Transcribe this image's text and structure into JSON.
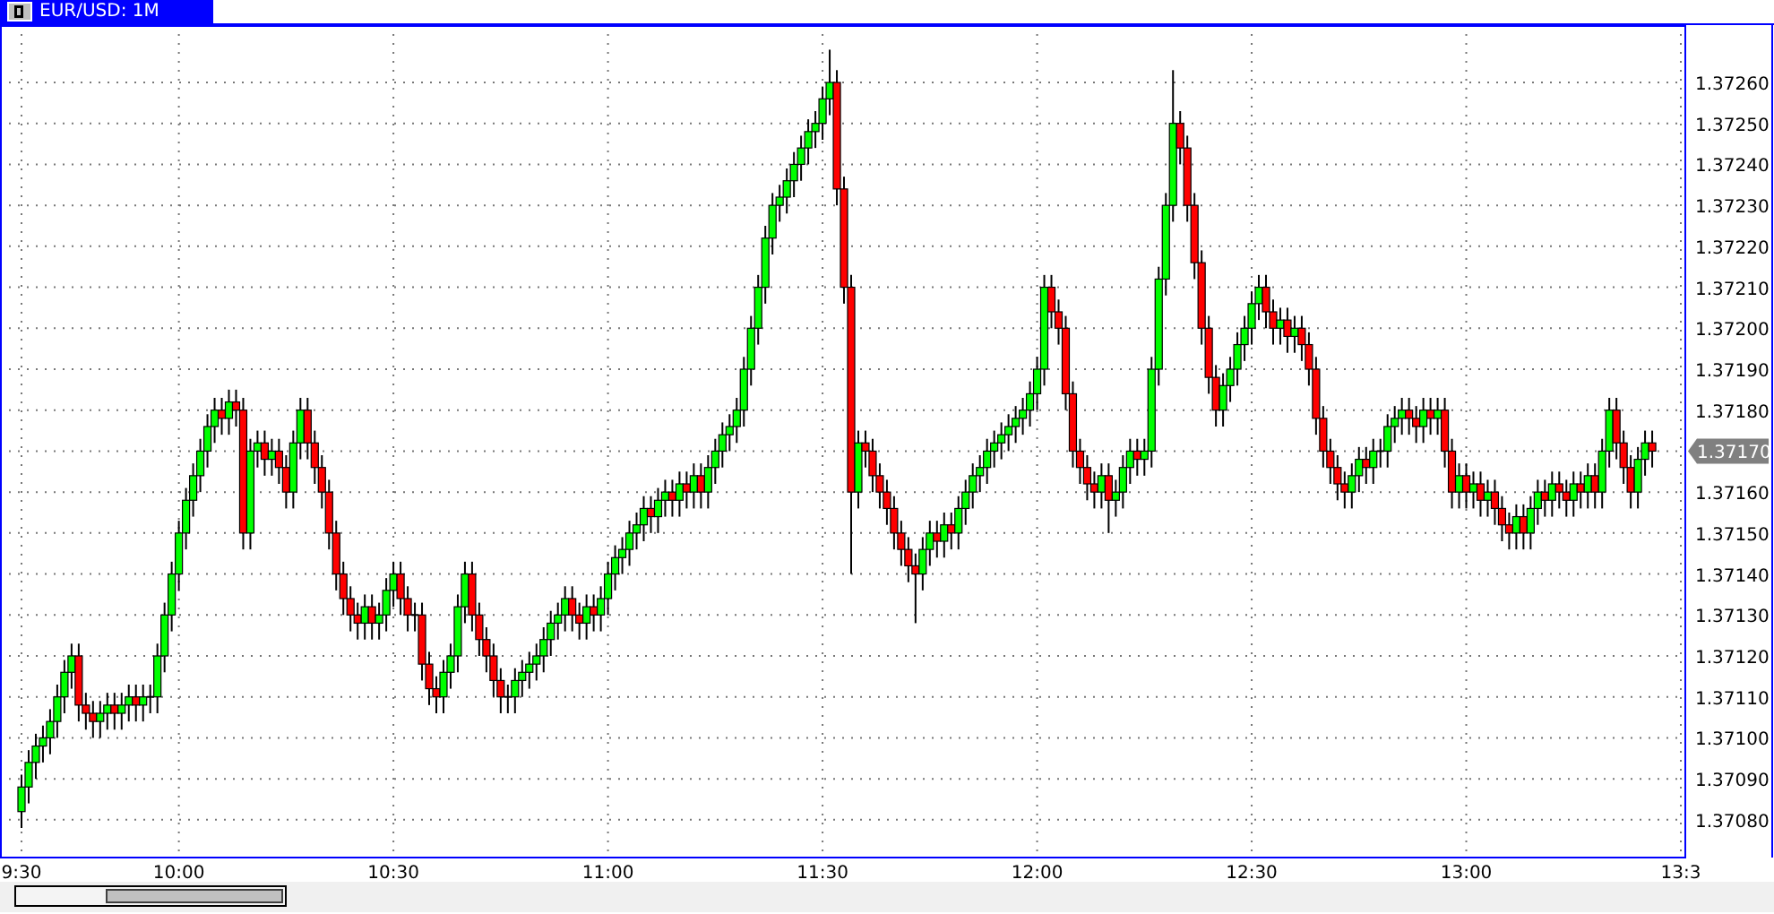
{
  "window": {
    "title": "EUR/USD: 1M"
  },
  "chart_data": {
    "type": "candlestick",
    "categories": [
      "9:30",
      null,
      null,
      null,
      null,
      null,
      null,
      null,
      null,
      null,
      null,
      null,
      null,
      null,
      null,
      null,
      null,
      null,
      null,
      null,
      null,
      null,
      "10:00",
      null,
      null,
      null,
      null,
      null,
      null,
      null,
      null,
      null,
      null,
      null,
      null,
      null,
      null,
      null,
      null,
      null,
      null,
      null,
      null,
      null,
      null,
      null,
      null,
      null,
      null,
      null,
      null,
      null,
      "10:30",
      null,
      null,
      null,
      null,
      null,
      null,
      null,
      null,
      null,
      null,
      null,
      null,
      null,
      null,
      null,
      null,
      null,
      null,
      null,
      null,
      null,
      null,
      null,
      null,
      null,
      null,
      null,
      null,
      null,
      "11:00",
      null,
      null,
      null,
      null,
      null,
      null,
      null,
      null,
      null,
      null,
      null,
      null,
      null,
      null,
      null,
      null,
      null,
      null,
      null,
      null,
      null,
      null,
      null,
      null,
      null,
      null,
      null,
      null,
      null,
      "11:30",
      null,
      null,
      null,
      null,
      null,
      null,
      null,
      null,
      null,
      null,
      null,
      null,
      null,
      null,
      null,
      null,
      null,
      null,
      null,
      null,
      null,
      null,
      null,
      null,
      null,
      null,
      null,
      null,
      null,
      "12:00",
      null,
      null,
      null,
      null,
      null,
      null,
      null,
      null,
      null,
      null,
      null,
      null,
      null,
      null,
      null,
      null,
      null,
      null,
      null,
      null,
      null,
      null,
      null,
      null,
      null,
      null,
      null,
      null,
      null,
      "12:30",
      null,
      null,
      null,
      null,
      null,
      null,
      null,
      null,
      null,
      null,
      null,
      null,
      null,
      null,
      null,
      null,
      null,
      null,
      null,
      null,
      null,
      null,
      null,
      null,
      null,
      null,
      null,
      null,
      null,
      "13:00",
      null,
      null,
      null,
      null,
      null,
      null,
      null,
      null,
      null,
      null,
      null,
      null,
      null,
      null,
      null,
      null,
      null,
      null,
      null,
      null,
      null,
      null,
      null,
      null,
      null,
      null,
      null,
      null,
      null,
      "13:3"
    ],
    "ohlc": [
      [
        1.37082,
        1.37091,
        1.37078,
        1.37088
      ],
      [
        1.37088,
        1.37097,
        1.37084,
        1.37094
      ],
      [
        1.37094,
        1.37101,
        1.3709,
        1.37098
      ],
      [
        1.37098,
        1.37103,
        1.37094,
        1.371
      ],
      [
        1.371,
        1.37107,
        1.37096,
        1.37104
      ],
      [
        1.37104,
        1.37113,
        1.371,
        1.3711
      ],
      [
        1.3711,
        1.37119,
        1.37106,
        1.37116
      ],
      [
        1.37116,
        1.37123,
        1.37112,
        1.3712
      ],
      [
        1.3712,
        1.37123,
        1.37104,
        1.37108
      ],
      [
        1.37108,
        1.37111,
        1.37102,
        1.37106
      ],
      [
        1.37106,
        1.37109,
        1.371,
        1.37104
      ],
      [
        1.37104,
        1.37109,
        1.371,
        1.37106
      ],
      [
        1.37106,
        1.37111,
        1.37102,
        1.37108
      ],
      [
        1.37108,
        1.37111,
        1.37102,
        1.37106
      ],
      [
        1.37106,
        1.37111,
        1.37102,
        1.37108
      ],
      [
        1.37108,
        1.37113,
        1.37104,
        1.3711
      ],
      [
        1.3711,
        1.37113,
        1.37104,
        1.37108
      ],
      [
        1.37108,
        1.37113,
        1.37104,
        1.3711
      ],
      [
        1.3711,
        1.37113,
        1.37106,
        1.3711
      ],
      [
        1.3711,
        1.37123,
        1.37106,
        1.3712
      ],
      [
        1.3712,
        1.37133,
        1.37116,
        1.3713
      ],
      [
        1.3713,
        1.37143,
        1.37126,
        1.3714
      ],
      [
        1.3714,
        1.37153,
        1.37136,
        1.3715
      ],
      [
        1.3715,
        1.37161,
        1.37146,
        1.37158
      ],
      [
        1.37158,
        1.37167,
        1.37154,
        1.37164
      ],
      [
        1.37164,
        1.37173,
        1.3716,
        1.3717
      ],
      [
        1.3717,
        1.37179,
        1.37166,
        1.37176
      ],
      [
        1.37176,
        1.37183,
        1.37172,
        1.3718
      ],
      [
        1.3718,
        1.37183,
        1.37174,
        1.37178
      ],
      [
        1.37178,
        1.37185,
        1.37174,
        1.37182
      ],
      [
        1.37182,
        1.37185,
        1.37176,
        1.3718
      ],
      [
        1.3718,
        1.37183,
        1.37146,
        1.3715
      ],
      [
        1.3715,
        1.37173,
        1.37146,
        1.3717
      ],
      [
        1.3717,
        1.37175,
        1.37166,
        1.37172
      ],
      [
        1.37172,
        1.37175,
        1.37164,
        1.37168
      ],
      [
        1.37168,
        1.37173,
        1.37164,
        1.3717
      ],
      [
        1.3717,
        1.37173,
        1.37162,
        1.37166
      ],
      [
        1.37166,
        1.37169,
        1.37156,
        1.3716
      ],
      [
        1.3716,
        1.37175,
        1.37156,
        1.37172
      ],
      [
        1.37172,
        1.37183,
        1.37168,
        1.3718
      ],
      [
        1.3718,
        1.37183,
        1.37168,
        1.37172
      ],
      [
        1.37172,
        1.37175,
        1.37162,
        1.37166
      ],
      [
        1.37166,
        1.37169,
        1.37156,
        1.3716
      ],
      [
        1.3716,
        1.37163,
        1.37146,
        1.3715
      ],
      [
        1.3715,
        1.37153,
        1.37136,
        1.3714
      ],
      [
        1.3714,
        1.37143,
        1.3713,
        1.37134
      ],
      [
        1.37134,
        1.37137,
        1.37126,
        1.3713
      ],
      [
        1.3713,
        1.37133,
        1.37124,
        1.37128
      ],
      [
        1.37128,
        1.37135,
        1.37124,
        1.37132
      ],
      [
        1.37132,
        1.37135,
        1.37124,
        1.37128
      ],
      [
        1.37128,
        1.37133,
        1.37124,
        1.3713
      ],
      [
        1.3713,
        1.37139,
        1.37126,
        1.37136
      ],
      [
        1.37136,
        1.37143,
        1.37132,
        1.3714
      ],
      [
        1.3714,
        1.37143,
        1.3713,
        1.37134
      ],
      [
        1.37134,
        1.37137,
        1.37126,
        1.3713
      ],
      [
        1.3713,
        1.37133,
        1.37126,
        1.3713
      ],
      [
        1.3713,
        1.37133,
        1.37114,
        1.37118
      ],
      [
        1.37118,
        1.37121,
        1.37108,
        1.37112
      ],
      [
        1.37112,
        1.37115,
        1.37106,
        1.3711
      ],
      [
        1.3711,
        1.37119,
        1.37106,
        1.37116
      ],
      [
        1.37116,
        1.37123,
        1.37112,
        1.3712
      ],
      [
        1.3712,
        1.37135,
        1.37116,
        1.37132
      ],
      [
        1.37132,
        1.37143,
        1.37128,
        1.3714
      ],
      [
        1.3714,
        1.37143,
        1.37126,
        1.3713
      ],
      [
        1.3713,
        1.37133,
        1.3712,
        1.37124
      ],
      [
        1.37124,
        1.37127,
        1.37116,
        1.3712
      ],
      [
        1.3712,
        1.37123,
        1.3711,
        1.37114
      ],
      [
        1.37114,
        1.37117,
        1.37106,
        1.3711
      ],
      [
        1.3711,
        1.37113,
        1.37106,
        1.3711
      ],
      [
        1.3711,
        1.37117,
        1.37106,
        1.37114
      ],
      [
        1.37114,
        1.37119,
        1.3711,
        1.37116
      ],
      [
        1.37116,
        1.37121,
        1.37112,
        1.37118
      ],
      [
        1.37118,
        1.37123,
        1.37114,
        1.3712
      ],
      [
        1.3712,
        1.37127,
        1.37116,
        1.37124
      ],
      [
        1.37124,
        1.37131,
        1.3712,
        1.37128
      ],
      [
        1.37128,
        1.37133,
        1.37124,
        1.3713
      ],
      [
        1.3713,
        1.37137,
        1.37126,
        1.37134
      ],
      [
        1.37134,
        1.37137,
        1.37126,
        1.3713
      ],
      [
        1.3713,
        1.37133,
        1.37124,
        1.37128
      ],
      [
        1.37128,
        1.37135,
        1.37124,
        1.37132
      ],
      [
        1.37132,
        1.37135,
        1.37126,
        1.3713
      ],
      [
        1.3713,
        1.37137,
        1.37126,
        1.37134
      ],
      [
        1.37134,
        1.37143,
        1.3713,
        1.3714
      ],
      [
        1.3714,
        1.37147,
        1.37136,
        1.37144
      ],
      [
        1.37144,
        1.37149,
        1.3714,
        1.37146
      ],
      [
        1.37146,
        1.37153,
        1.37142,
        1.3715
      ],
      [
        1.3715,
        1.37155,
        1.37146,
        1.37152
      ],
      [
        1.37152,
        1.37159,
        1.37148,
        1.37156
      ],
      [
        1.37156,
        1.37159,
        1.3715,
        1.37154
      ],
      [
        1.37154,
        1.37161,
        1.3715,
        1.37158
      ],
      [
        1.37158,
        1.37163,
        1.37154,
        1.3716
      ],
      [
        1.3716,
        1.37163,
        1.37154,
        1.37158
      ],
      [
        1.37158,
        1.37165,
        1.37154,
        1.37162
      ],
      [
        1.37162,
        1.37165,
        1.37156,
        1.3716
      ],
      [
        1.3716,
        1.37167,
        1.37156,
        1.37164
      ],
      [
        1.37164,
        1.37167,
        1.37156,
        1.3716
      ],
      [
        1.3716,
        1.37169,
        1.37156,
        1.37166
      ],
      [
        1.37166,
        1.37173,
        1.37162,
        1.3717
      ],
      [
        1.3717,
        1.37177,
        1.37166,
        1.37174
      ],
      [
        1.37174,
        1.37179,
        1.3717,
        1.37176
      ],
      [
        1.37176,
        1.37183,
        1.37172,
        1.3718
      ],
      [
        1.3718,
        1.37193,
        1.37176,
        1.3719
      ],
      [
        1.3719,
        1.37203,
        1.37186,
        1.372
      ],
      [
        1.372,
        1.37213,
        1.37196,
        1.3721
      ],
      [
        1.3721,
        1.37225,
        1.37206,
        1.37222
      ],
      [
        1.37222,
        1.37233,
        1.37218,
        1.3723
      ],
      [
        1.3723,
        1.37235,
        1.37226,
        1.37232
      ],
      [
        1.37232,
        1.37239,
        1.37228,
        1.37236
      ],
      [
        1.37236,
        1.37243,
        1.37232,
        1.3724
      ],
      [
        1.3724,
        1.37247,
        1.37236,
        1.37244
      ],
      [
        1.37244,
        1.37251,
        1.3724,
        1.37248
      ],
      [
        1.37248,
        1.37253,
        1.37244,
        1.3725
      ],
      [
        1.3725,
        1.37259,
        1.37246,
        1.37256
      ],
      [
        1.37256,
        1.37268,
        1.37252,
        1.3726
      ],
      [
        1.3726,
        1.37263,
        1.3723,
        1.37234
      ],
      [
        1.37234,
        1.37237,
        1.37206,
        1.3721
      ],
      [
        1.3721,
        1.37213,
        1.3714,
        1.3716
      ],
      [
        1.3716,
        1.37175,
        1.37156,
        1.37172
      ],
      [
        1.37172,
        1.37175,
        1.37166,
        1.3717
      ],
      [
        1.3717,
        1.37173,
        1.3716,
        1.37164
      ],
      [
        1.37164,
        1.37167,
        1.37156,
        1.3716
      ],
      [
        1.3716,
        1.37163,
        1.37152,
        1.37156
      ],
      [
        1.37156,
        1.37159,
        1.37146,
        1.3715
      ],
      [
        1.3715,
        1.37153,
        1.37142,
        1.37146
      ],
      [
        1.37146,
        1.37149,
        1.37138,
        1.37142
      ],
      [
        1.37142,
        1.37145,
        1.37128,
        1.3714
      ],
      [
        1.3714,
        1.37149,
        1.37136,
        1.37146
      ],
      [
        1.37146,
        1.37153,
        1.37142,
        1.3715
      ],
      [
        1.3715,
        1.37153,
        1.37144,
        1.37148
      ],
      [
        1.37148,
        1.37155,
        1.37144,
        1.37152
      ],
      [
        1.37152,
        1.37155,
        1.37146,
        1.3715
      ],
      [
        1.3715,
        1.37159,
        1.37146,
        1.37156
      ],
      [
        1.37156,
        1.37163,
        1.37152,
        1.3716
      ],
      [
        1.3716,
        1.37167,
        1.37156,
        1.37164
      ],
      [
        1.37164,
        1.37169,
        1.3716,
        1.37166
      ],
      [
        1.37166,
        1.37173,
        1.37162,
        1.3717
      ],
      [
        1.3717,
        1.37175,
        1.37166,
        1.37172
      ],
      [
        1.37172,
        1.37177,
        1.37168,
        1.37174
      ],
      [
        1.37174,
        1.37179,
        1.3717,
        1.37176
      ],
      [
        1.37176,
        1.37181,
        1.37172,
        1.37178
      ],
      [
        1.37178,
        1.37183,
        1.37174,
        1.3718
      ],
      [
        1.3718,
        1.37187,
        1.37176,
        1.37184
      ],
      [
        1.37184,
        1.37193,
        1.3718,
        1.3719
      ],
      [
        1.3719,
        1.37213,
        1.37186,
        1.3721
      ],
      [
        1.3721,
        1.37213,
        1.372,
        1.37204
      ],
      [
        1.37204,
        1.37207,
        1.37196,
        1.372
      ],
      [
        1.372,
        1.37203,
        1.3718,
        1.37184
      ],
      [
        1.37184,
        1.37187,
        1.37166,
        1.3717
      ],
      [
        1.3717,
        1.37173,
        1.37162,
        1.37166
      ],
      [
        1.37166,
        1.37169,
        1.37158,
        1.37162
      ],
      [
        1.37162,
        1.37165,
        1.37156,
        1.3716
      ],
      [
        1.3716,
        1.37167,
        1.37156,
        1.37164
      ],
      [
        1.37164,
        1.37167,
        1.3715,
        1.37158
      ],
      [
        1.37158,
        1.37163,
        1.37154,
        1.3716
      ],
      [
        1.3716,
        1.37169,
        1.37156,
        1.37166
      ],
      [
        1.37166,
        1.37173,
        1.37162,
        1.3717
      ],
      [
        1.3717,
        1.37173,
        1.37164,
        1.37168
      ],
      [
        1.37168,
        1.37173,
        1.37164,
        1.3717
      ],
      [
        1.3717,
        1.37193,
        1.37166,
        1.3719
      ],
      [
        1.3719,
        1.37215,
        1.37186,
        1.37212
      ],
      [
        1.37212,
        1.37233,
        1.37208,
        1.3723
      ],
      [
        1.3723,
        1.37263,
        1.37226,
        1.3725
      ],
      [
        1.3725,
        1.37253,
        1.3724,
        1.37244
      ],
      [
        1.37244,
        1.37247,
        1.37226,
        1.3723
      ],
      [
        1.3723,
        1.37233,
        1.37212,
        1.37216
      ],
      [
        1.37216,
        1.37219,
        1.37196,
        1.372
      ],
      [
        1.372,
        1.37203,
        1.37184,
        1.37188
      ],
      [
        1.37188,
        1.37191,
        1.37176,
        1.3718
      ],
      [
        1.3718,
        1.37189,
        1.37176,
        1.37186
      ],
      [
        1.37186,
        1.37193,
        1.37182,
        1.3719
      ],
      [
        1.3719,
        1.37199,
        1.37186,
        1.37196
      ],
      [
        1.37196,
        1.37203,
        1.37192,
        1.372
      ],
      [
        1.372,
        1.37209,
        1.37196,
        1.37206
      ],
      [
        1.37206,
        1.37213,
        1.37202,
        1.3721
      ],
      [
        1.3721,
        1.37213,
        1.372,
        1.37204
      ],
      [
        1.37204,
        1.37207,
        1.37196,
        1.372
      ],
      [
        1.372,
        1.37205,
        1.37196,
        1.37202
      ],
      [
        1.37202,
        1.37205,
        1.37194,
        1.37198
      ],
      [
        1.37198,
        1.37203,
        1.37194,
        1.372
      ],
      [
        1.372,
        1.37203,
        1.37192,
        1.37196
      ],
      [
        1.37196,
        1.37199,
        1.37186,
        1.3719
      ],
      [
        1.3719,
        1.37193,
        1.37174,
        1.37178
      ],
      [
        1.37178,
        1.37181,
        1.37166,
        1.3717
      ],
      [
        1.3717,
        1.37173,
        1.37162,
        1.37166
      ],
      [
        1.37166,
        1.37169,
        1.37158,
        1.37162
      ],
      [
        1.37162,
        1.37165,
        1.37156,
        1.3716
      ],
      [
        1.3716,
        1.37167,
        1.37156,
        1.37164
      ],
      [
        1.37164,
        1.37171,
        1.3716,
        1.37168
      ],
      [
        1.37168,
        1.37171,
        1.37162,
        1.37166
      ],
      [
        1.37166,
        1.37173,
        1.37162,
        1.3717
      ],
      [
        1.3717,
        1.37173,
        1.37166,
        1.3717
      ],
      [
        1.3717,
        1.37179,
        1.37166,
        1.37176
      ],
      [
        1.37176,
        1.37181,
        1.37172,
        1.37178
      ],
      [
        1.37178,
        1.37183,
        1.37174,
        1.3718
      ],
      [
        1.3718,
        1.37183,
        1.37174,
        1.37178
      ],
      [
        1.37178,
        1.37181,
        1.37172,
        1.37176
      ],
      [
        1.37176,
        1.37183,
        1.37172,
        1.3718
      ],
      [
        1.3718,
        1.37183,
        1.37174,
        1.37178
      ],
      [
        1.37178,
        1.37183,
        1.37174,
        1.3718
      ],
      [
        1.3718,
        1.37183,
        1.37166,
        1.3717
      ],
      [
        1.3717,
        1.37173,
        1.37156,
        1.3716
      ],
      [
        1.3716,
        1.37167,
        1.37156,
        1.37164
      ],
      [
        1.37164,
        1.37167,
        1.37156,
        1.3716
      ],
      [
        1.3716,
        1.37165,
        1.37156,
        1.37162
      ],
      [
        1.37162,
        1.37165,
        1.37154,
        1.37158
      ],
      [
        1.37158,
        1.37163,
        1.37154,
        1.3716
      ],
      [
        1.3716,
        1.37163,
        1.37152,
        1.37156
      ],
      [
        1.37156,
        1.37159,
        1.37148,
        1.37152
      ],
      [
        1.37152,
        1.37155,
        1.37146,
        1.3715
      ],
      [
        1.3715,
        1.37157,
        1.37146,
        1.37154
      ],
      [
        1.37154,
        1.37157,
        1.37146,
        1.3715
      ],
      [
        1.3715,
        1.37159,
        1.37146,
        1.37156
      ],
      [
        1.37156,
        1.37163,
        1.37152,
        1.3716
      ],
      [
        1.3716,
        1.37163,
        1.37154,
        1.37158
      ],
      [
        1.37158,
        1.37165,
        1.37154,
        1.37162
      ],
      [
        1.37162,
        1.37165,
        1.37156,
        1.3716
      ],
      [
        1.3716,
        1.37163,
        1.37154,
        1.37158
      ],
      [
        1.37158,
        1.37165,
        1.37154,
        1.37162
      ],
      [
        1.37162,
        1.37165,
        1.37156,
        1.3716
      ],
      [
        1.3716,
        1.37167,
        1.37156,
        1.37164
      ],
      [
        1.37164,
        1.37167,
        1.37156,
        1.3716
      ],
      [
        1.3716,
        1.37173,
        1.37156,
        1.3717
      ],
      [
        1.3717,
        1.37183,
        1.37166,
        1.3718
      ],
      [
        1.3718,
        1.37183,
        1.37168,
        1.37172
      ],
      [
        1.37172,
        1.37175,
        1.37162,
        1.37166
      ],
      [
        1.37166,
        1.37169,
        1.37156,
        1.3716
      ],
      [
        1.3716,
        1.37171,
        1.37156,
        1.37168
      ],
      [
        1.37168,
        1.37175,
        1.37164,
        1.37172
      ],
      [
        1.37172,
        1.37175,
        1.37166,
        1.3717
      ],
      null,
      null,
      null,
      null
    ],
    "ylim": [
      1.37071,
      1.37274
    ],
    "yticks": [
      {
        "value": 1.3726,
        "label": "1.37260"
      },
      {
        "value": 1.3725,
        "label": "1.37250"
      },
      {
        "value": 1.3724,
        "label": "1.37240"
      },
      {
        "value": 1.3723,
        "label": "1.37230"
      },
      {
        "value": 1.3722,
        "label": "1.37220"
      },
      {
        "value": 1.3721,
        "label": "1.37210"
      },
      {
        "value": 1.372,
        "label": "1.37200"
      },
      {
        "value": 1.3719,
        "label": "1.37190"
      },
      {
        "value": 1.3718,
        "label": "1.37180"
      },
      {
        "value": 1.3716,
        "label": "1.37160"
      },
      {
        "value": 1.3715,
        "label": "1.37150"
      },
      {
        "value": 1.3714,
        "label": "1.37140"
      },
      {
        "value": 1.3713,
        "label": "1.37130"
      },
      {
        "value": 1.3712,
        "label": "1.37120"
      },
      {
        "value": 1.3711,
        "label": "1.37110"
      },
      {
        "value": 1.371,
        "label": "1.37100"
      },
      {
        "value": 1.3709,
        "label": "1.37090"
      },
      {
        "value": 1.3708,
        "label": "1.37080"
      }
    ],
    "grid": true,
    "annotations": [
      "1.37170"
    ]
  }
}
